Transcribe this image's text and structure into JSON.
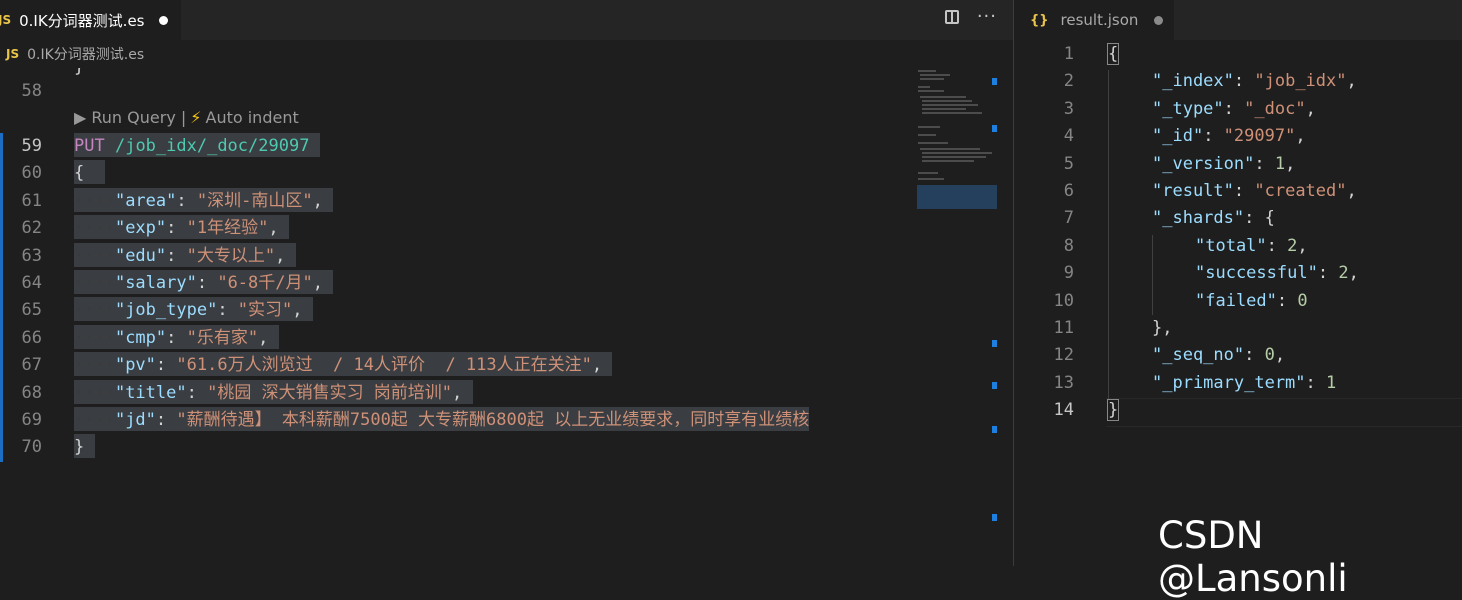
{
  "left_tab": {
    "badge": "JS",
    "filename": "0.IK分词器测试.es"
  },
  "breadcrumb": {
    "badge": "JS",
    "filename": "0.IK分词器测试.es"
  },
  "right_tab": {
    "badge": "{}",
    "filename": "result.json"
  },
  "codelens": {
    "run_query": "▶ Run Query |",
    "bolt": "⚡",
    "auto_indent": "Auto indent"
  },
  "left_editor": {
    "lines": [
      {
        "num": "58"
      },
      {
        "num": "59",
        "method": "PUT",
        "path": "/job_idx/_doc/29097"
      },
      {
        "num": "60",
        "text": "{"
      },
      {
        "num": "61",
        "key": "\"area\"",
        "sep": ": ",
        "value": "\"深圳-南山区\"",
        "end": ","
      },
      {
        "num": "62",
        "key": "\"exp\"",
        "sep": ": ",
        "value": "\"1年经验\"",
        "end": ","
      },
      {
        "num": "63",
        "key": "\"edu\"",
        "sep": ": ",
        "value": "\"大专以上\"",
        "end": ","
      },
      {
        "num": "64",
        "key": "\"salary\"",
        "sep": ": ",
        "value": "\"6-8千/月\"",
        "end": ","
      },
      {
        "num": "65",
        "key": "\"job_type\"",
        "sep": ": ",
        "value": "\"实习\"",
        "end": ","
      },
      {
        "num": "66",
        "key": "\"cmp\"",
        "sep": ": ",
        "value": "\"乐有家\"",
        "end": ","
      },
      {
        "num": "67",
        "key": "\"pv\"",
        "sep": ": ",
        "value": "\"61.6万人浏览过  / 14人评价  / 113人正在关注\"",
        "end": ","
      },
      {
        "num": "68",
        "key": "\"title\"",
        "sep": ": ",
        "value": "\"桃园 深大销售实习 岗前培训\"",
        "end": ","
      },
      {
        "num": "69",
        "key": "\"jd\"",
        "sep": ": ",
        "value": "\"薪酬待遇】 本科薪酬7500起 大专薪酬6800起 以上无业绩要求，同时享有业绩核",
        "end": ""
      },
      {
        "num": "70",
        "text": "}"
      }
    ]
  },
  "right_editor": {
    "lines": [
      {
        "num": "1",
        "text": "{"
      },
      {
        "num": "2",
        "key": "\"_index\"",
        "value": "\"job_idx\"",
        "type": "s",
        "end": ","
      },
      {
        "num": "3",
        "key": "\"_type\"",
        "value": "\"_doc\"",
        "type": "s",
        "end": ","
      },
      {
        "num": "4",
        "key": "\"_id\"",
        "value": "\"29097\"",
        "type": "s",
        "end": ","
      },
      {
        "num": "5",
        "key": "\"_version\"",
        "value": "1",
        "type": "n",
        "end": ","
      },
      {
        "num": "6",
        "key": "\"result\"",
        "value": "\"created\"",
        "type": "s",
        "end": ","
      },
      {
        "num": "7",
        "key": "\"_shards\"",
        "value": "{",
        "type": "p",
        "end": ""
      },
      {
        "num": "8",
        "key": "\"total\"",
        "value": "2",
        "type": "n",
        "end": ","
      },
      {
        "num": "9",
        "key": "\"successful\"",
        "value": "2",
        "type": "n",
        "end": ","
      },
      {
        "num": "10",
        "key": "\"failed\"",
        "value": "0",
        "type": "n",
        "end": ""
      },
      {
        "num": "11",
        "text": "},"
      },
      {
        "num": "12",
        "key": "\"_seq_no\"",
        "value": "0",
        "type": "n",
        "end": ","
      },
      {
        "num": "13",
        "key": "\"_primary_term\"",
        "value": "1",
        "type": "n",
        "end": ""
      },
      {
        "num": "14",
        "text": "}"
      }
    ]
  },
  "watermark": "CSDN @Lansonli",
  "colors": {
    "accent_bar": "#1b6ec2",
    "keyword_put": "#c586c0",
    "url": "#4ec9b0",
    "key": "#9cdcfe",
    "string": "#ce9178",
    "number": "#b5cea8"
  }
}
